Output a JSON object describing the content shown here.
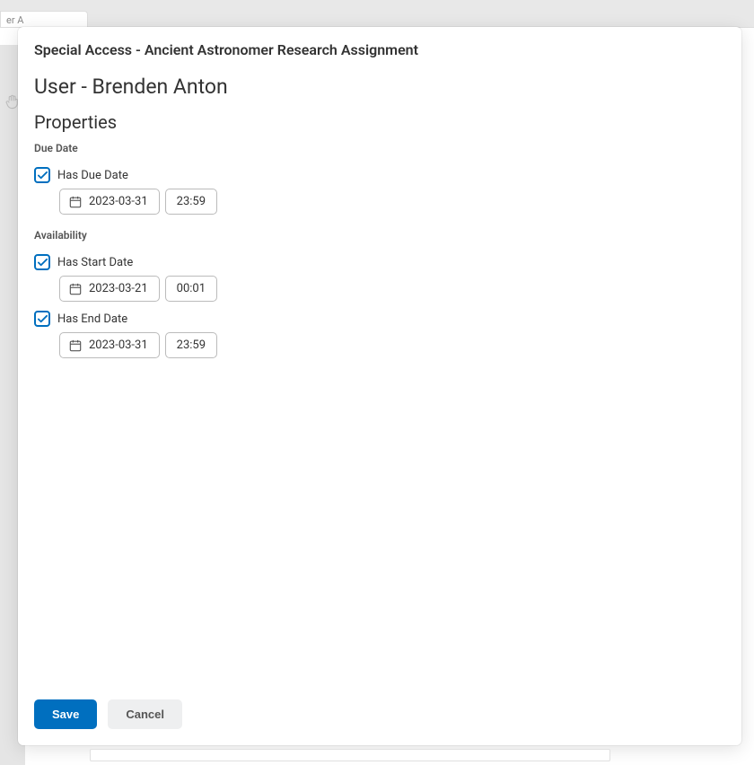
{
  "tab_hint": "er A",
  "modal": {
    "title": "Special Access - Ancient Astronomer Research Assignment",
    "user_heading": "User - Brenden Anton",
    "properties_heading": "Properties",
    "sections": {
      "due_date": {
        "label": "Due Date",
        "has_label": "Has Due Date",
        "checked": true,
        "date": "2023-03-31",
        "time": "23:59"
      },
      "availability_label": "Availability",
      "start_date": {
        "has_label": "Has Start Date",
        "checked": true,
        "date": "2023-03-21",
        "time": "00:01"
      },
      "end_date": {
        "has_label": "Has End Date",
        "checked": true,
        "date": "2023-03-31",
        "time": "23:59"
      }
    },
    "buttons": {
      "save": "Save",
      "cancel": "Cancel"
    }
  }
}
